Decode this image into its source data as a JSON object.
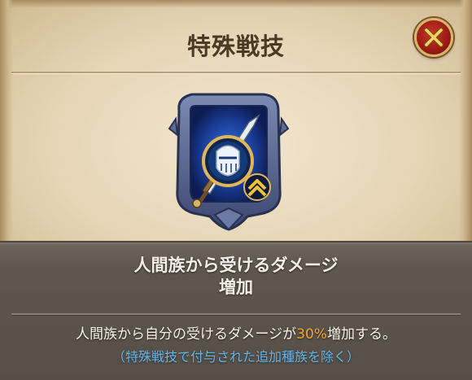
{
  "dialog": {
    "title": "特殊戦技",
    "close_icon": "close-x-icon",
    "emblem_icon": "knight-helmet-sword-rank-icon"
  },
  "skill": {
    "name_line1": "人間族から受けるダメージ",
    "name_line2": "増加",
    "description_prefix": "人間族から自分の受けるダメージが",
    "description_value": "30%",
    "description_suffix": "増加する。",
    "note": "（特殊戦技で付与された追加種族を除く）"
  },
  "colors": {
    "title_text": "#4a3a26",
    "highlight": "#f0a92a",
    "note_text": "#5fb7ee",
    "close_button": "#b0251c"
  }
}
